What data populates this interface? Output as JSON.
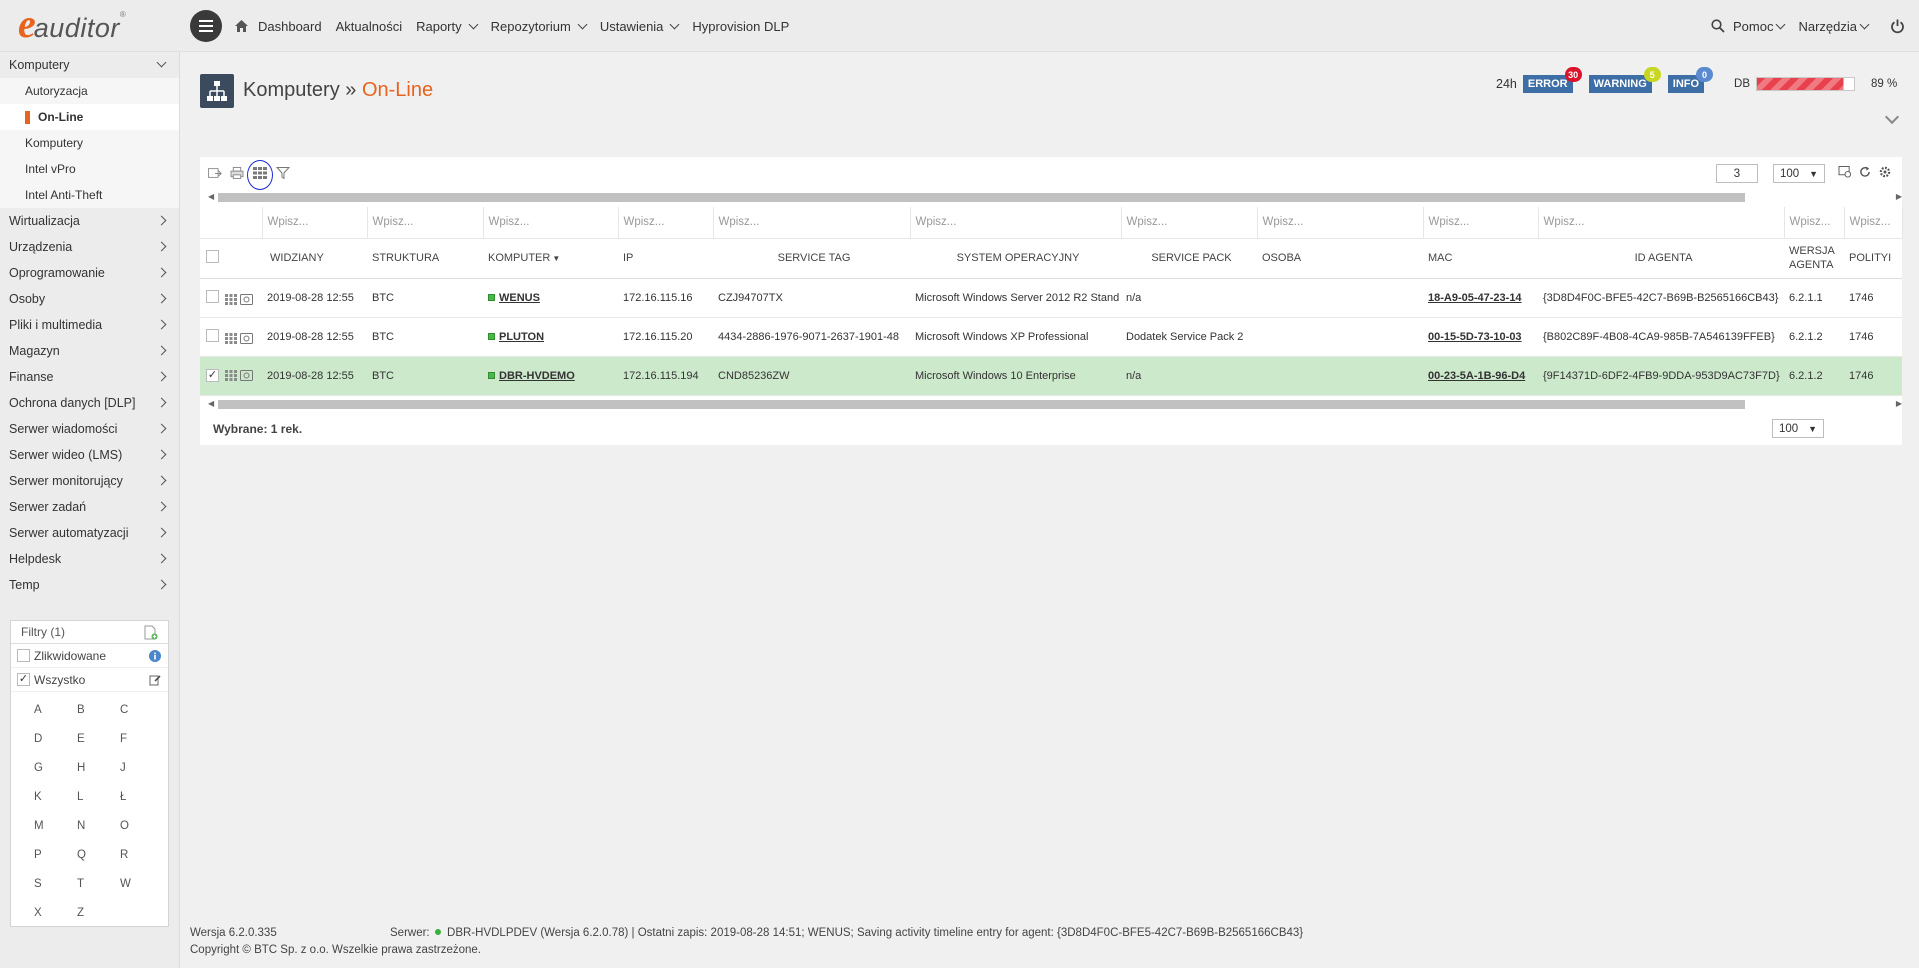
{
  "brand": {
    "logo_letter": "e",
    "logo_word": "auditor",
    "logo_mark": "®"
  },
  "nav": {
    "items": [
      {
        "label": "Dashboard",
        "icon": "home-icon"
      },
      {
        "label": "Aktualności"
      },
      {
        "label": "Raporty",
        "dropdown": true
      },
      {
        "label": "Repozytorium",
        "dropdown": true
      },
      {
        "label": "Ustawienia",
        "dropdown": true
      },
      {
        "label": "Hyprovision DLP"
      }
    ],
    "right": [
      {
        "label": "Pomoc",
        "icon": "search-icon"
      },
      {
        "label": "Narzędzia"
      }
    ]
  },
  "sidebar": {
    "items": [
      {
        "label": "Komputery",
        "type": "head",
        "expanded": true
      },
      {
        "label": "Autoryzacja",
        "type": "sub"
      },
      {
        "label": "On-Line",
        "type": "sub",
        "active": true
      },
      {
        "label": "Komputery",
        "type": "sub"
      },
      {
        "label": "Intel vPro",
        "type": "sub"
      },
      {
        "label": "Intel Anti-Theft",
        "type": "sub"
      },
      {
        "label": "Wirtualizacja"
      },
      {
        "label": "Urządzenia"
      },
      {
        "label": "Oprogramowanie"
      },
      {
        "label": "Osoby"
      },
      {
        "label": "Pliki i multimedia"
      },
      {
        "label": "Magazyn"
      },
      {
        "label": "Finanse"
      },
      {
        "label": "Ochrona danych [DLP]"
      },
      {
        "label": "Serwer wiadomości"
      },
      {
        "label": "Serwer wideo (LMS)"
      },
      {
        "label": "Serwer monitorujący"
      },
      {
        "label": "Serwer zadań"
      },
      {
        "label": "Serwer automatyzacji"
      },
      {
        "label": "Helpdesk"
      },
      {
        "label": "Temp"
      }
    ]
  },
  "filters": {
    "title": "Filtry (1)",
    "rows": [
      {
        "label": "Zlikwidowane",
        "checked": false
      },
      {
        "label": "Wszystko",
        "checked": true
      }
    ],
    "letters": [
      "A",
      "B",
      "C",
      "D",
      "E",
      "F",
      "G",
      "H",
      "J",
      "K",
      "L",
      "Ł",
      "M",
      "N",
      "O",
      "P",
      "Q",
      "R",
      "S",
      "T",
      "W",
      "X",
      "Z"
    ]
  },
  "page": {
    "title": "Komputery",
    "separator": "»",
    "subtitle": "On-Line"
  },
  "status": {
    "period": "24h",
    "error": {
      "label": "ERROR",
      "count": "30"
    },
    "warning": {
      "label": "WARNING",
      "count": "5"
    },
    "info": {
      "label": "INFO",
      "count": "0"
    },
    "db_label": "DB",
    "db_percent": "89 %",
    "db_fill": 0.89
  },
  "pager": {
    "page": "3",
    "page_size": "100",
    "bottom_page_size": "100"
  },
  "grid": {
    "filter_placeholder": "Wpisz...",
    "columns": [
      "WIDZIANY",
      "STRUKTURA",
      "KOMPUTER",
      "IP",
      "SERVICE TAG",
      "SYSTEM OPERACYJNY",
      "SERVICE PACK",
      "OSOBA",
      "MAC",
      "ID AGENTA",
      "WERSJA AGENTA",
      "POLITYI"
    ],
    "rows": [
      {
        "seen": "2019-08-28 12:55",
        "structure": "BTC",
        "computer": "WENUS",
        "ip": "172.16.115.16",
        "service_tag": "CZJ94707TX",
        "os": "Microsoft Windows Server 2012 R2 Stand",
        "service_pack": "n/a",
        "person": "",
        "mac": "18-A9-05-47-23-14",
        "agent_id": "{3D8D4F0C-BFE5-42C7-B69B-B2565166CB43}",
        "agent_version": "6.2.1.1",
        "policy": "1746",
        "selected": false
      },
      {
        "seen": "2019-08-28 12:55",
        "structure": "BTC",
        "computer": "PLUTON",
        "ip": "172.16.115.20",
        "service_tag": "4434-2886-1976-9071-2637-1901-48",
        "os": "Microsoft Windows XP Professional",
        "service_pack": "Dodatek Service Pack 2",
        "person": "",
        "mac": "00-15-5D-73-10-03",
        "agent_id": "{B802C89F-4B08-4CA9-985B-7A546139FFEB}",
        "agent_version": "6.2.1.2",
        "policy": "1746",
        "selected": false
      },
      {
        "seen": "2019-08-28 12:55",
        "structure": "BTC",
        "computer": "DBR-HVDEMO",
        "ip": "172.16.115.194",
        "service_tag": "CND85236ZW",
        "os": "Microsoft Windows 10 Enterprise",
        "service_pack": "n/a",
        "person": "",
        "mac": "00-23-5A-1B-96-D4",
        "agent_id": "{9F14371D-6DF2-4FB9-9DDA-953D9AC73F7D}",
        "agent_version": "6.2.1.2",
        "policy": "1746",
        "selected": true
      }
    ],
    "selected_label": "Wybrane: 1 rek."
  },
  "footer": {
    "version": "Wersja 6.2.0.335",
    "server_label": "Serwer:",
    "server_text": "DBR-HVDLPDEV (Wersja 6.2.0.78) | Ostatni zapis: 2019-08-28 14:51; WENUS; Saving activity timeline entry for agent: {3D8D4F0C-BFE5-42C7-B69B-B2565166CB43}",
    "copyright": "Copyright © BTC Sp. z o.o. Wszelkie prawa zastrzeżone."
  },
  "colors": {
    "accent": "#e8641e",
    "badge_blue": "#3d6ea5",
    "error_red": "#d9142b",
    "warning_yellow": "#c7d61e",
    "info_blue": "#5a8ad0",
    "selected_row": "#cde9cc"
  }
}
